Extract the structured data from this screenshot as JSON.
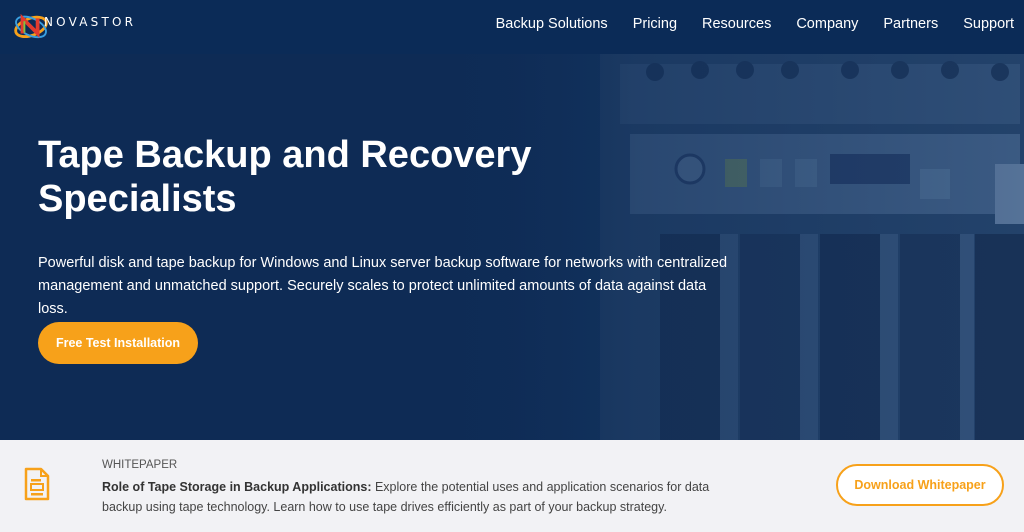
{
  "brand": {
    "name": "NOVASTOR",
    "logo_icon": "novastor-logo-icon"
  },
  "nav": {
    "items": [
      {
        "label": "Backup Solutions"
      },
      {
        "label": "Pricing"
      },
      {
        "label": "Resources"
      },
      {
        "label": "Company"
      },
      {
        "label": "Partners"
      },
      {
        "label": "Support"
      }
    ]
  },
  "hero": {
    "title": "Tape Backup and Recovery Specialists",
    "description": "Powerful disk and tape backup for Windows and Linux server backup software for networks with centralized management and unmatched support. Securely scales to protect unlimited amounts of data against data loss.",
    "cta_label": "Free Test Installation"
  },
  "whitepaper": {
    "label": "WHITEPAPER",
    "title": "Role of Tape Storage in Backup Applications:",
    "text": " Explore the potential uses and application scenarios for data backup using tape technology. Learn how to use tape drives efficiently as part of your backup strategy.",
    "button_label": "Download Whitepaper",
    "icon": "document-icon"
  },
  "colors": {
    "header_bg": "#0b2b57",
    "accent": "#f7a11a",
    "hero_bg": "#0e2b55",
    "banner_bg": "#f2f2f5"
  }
}
